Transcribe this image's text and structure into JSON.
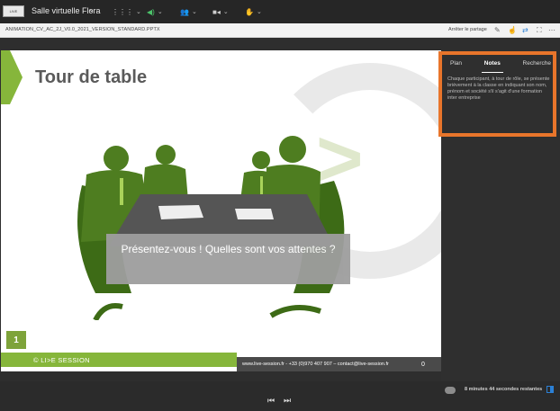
{
  "topbar": {
    "room_title": "Salle virtuelle Flora",
    "icons": [
      "grid-icon",
      "speaker-icon",
      "people-icon",
      "camera-icon",
      "hand-icon"
    ]
  },
  "docbar": {
    "file_name": "ANIMATION_CV_AC_2J_V0.0_2021_VERSION_STANDARD.PPTX",
    "stop_share": "Arrêter le partage"
  },
  "slide": {
    "title": "Tour de table",
    "caption": "Présentez-vous ! Quelles sont vos attentes ?",
    "page_number": "1",
    "footer_logo": "© LI>E SESSION",
    "footer_contact": "www.live-session.fr - +33 (0)970 407 907 – contact@live-session.fr",
    "footer_counter": "0",
    "accent_color": "#86b63b"
  },
  "panel": {
    "tabs": [
      "Plan",
      "Notes",
      "Recherche"
    ],
    "active_tab": "Notes",
    "notes": "Chaque participant, à tour de rôle, se présente brièvement à la classe en indiquant son nom, prénom et société s'il s'agit d'une formation inter entreprise"
  },
  "status": {
    "time_remaining": "8 minutes 44 secondes restantes"
  }
}
